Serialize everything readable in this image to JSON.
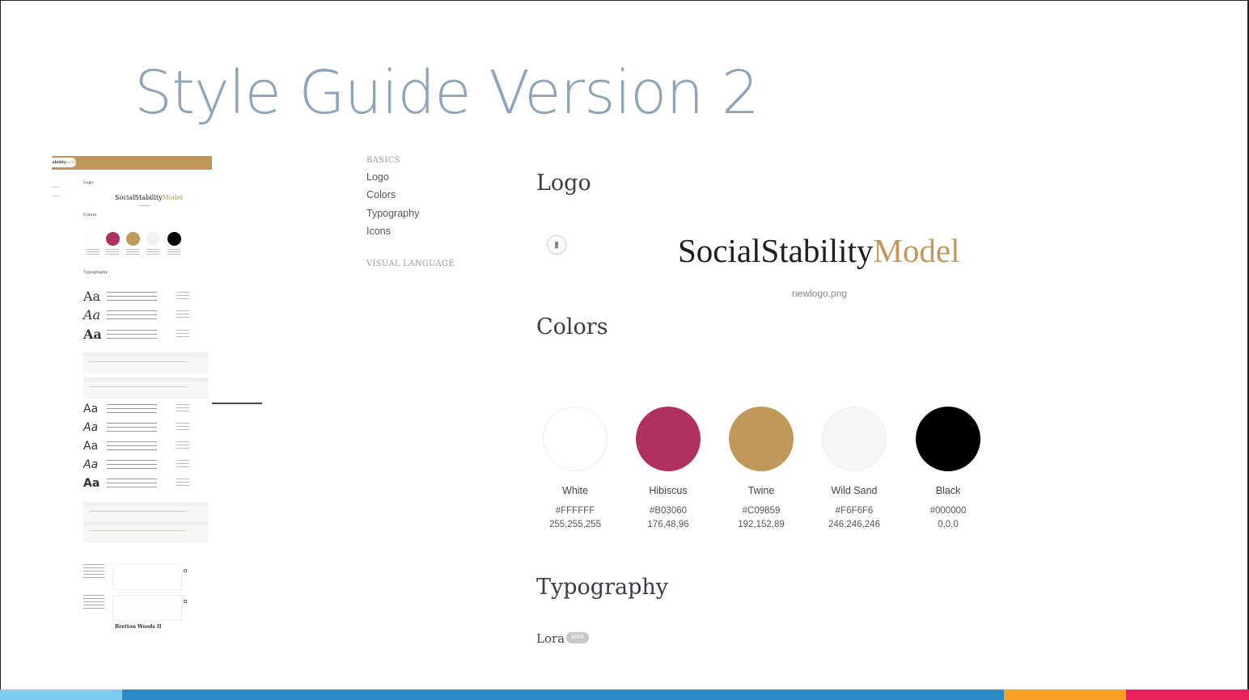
{
  "slide": {
    "title": "Style Guide Version 2"
  },
  "thumbnail": {
    "brand_part1": "SocialStability",
    "brand_part2": "Model",
    "brand_short": "tability",
    "brand_short_accent": "model",
    "sections": {
      "logo": "Logo",
      "colors": "Colors",
      "typography": "Typography"
    },
    "aa_glyph": "Aa",
    "sample_heading": "Bretton Woods II",
    "swatch_colors": [
      "#FFFFFF",
      "#B03060",
      "#C09859",
      "#F6F6F6",
      "#000000"
    ]
  },
  "nav": {
    "basics_heading": "BASICS",
    "items": [
      "Logo",
      "Colors",
      "Typography",
      "Icons"
    ],
    "visual_heading": "VISUAL LANGUAGE"
  },
  "logo_section": {
    "title": "Logo",
    "icon": "image-file-icon",
    "logo_part1": "SocialStability",
    "logo_part2": "Model",
    "filename": "newlogo.png"
  },
  "colors_section": {
    "title": "Colors",
    "swatches": [
      {
        "name": "White",
        "hex": "#FFFFFF",
        "rgb": "255,255,255"
      },
      {
        "name": "Hibiscus",
        "hex": "#B03060",
        "rgb": "176,48,96"
      },
      {
        "name": "Twine",
        "hex": "#C09859",
        "rgb": "192,152,89"
      },
      {
        "name": "Wild Sand",
        "hex": "#F6F6F6",
        "rgb": "246,246,246"
      },
      {
        "name": "Black",
        "hex": "#000000",
        "rgb": "0,0,0"
      }
    ]
  },
  "typography_section": {
    "title": "Typography",
    "font_name": "Lora",
    "badge": "WEB"
  },
  "stripe_colors": [
    "#7fcbf2",
    "#2a8ac6",
    "#f7a023",
    "#e8215a"
  ]
}
